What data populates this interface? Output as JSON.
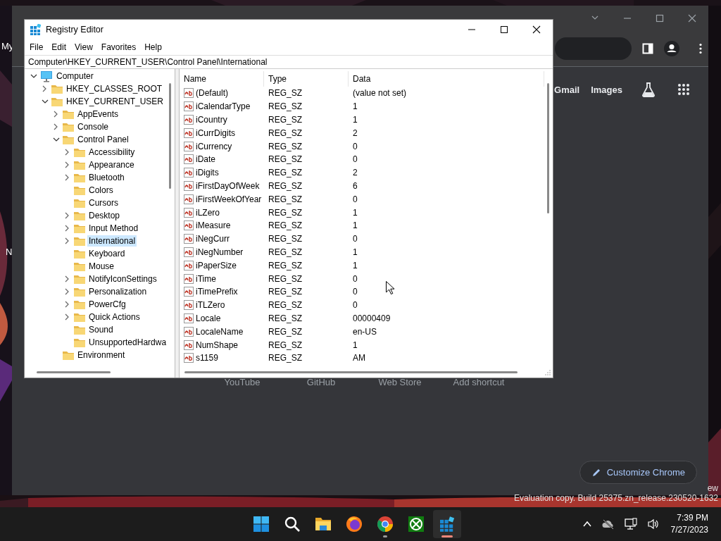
{
  "desktop": {
    "icon_labels": [
      "My",
      "N"
    ],
    "watermark_lines": [
      "ew",
      "Evaluation copy. Build 25375.zn_release.230520-1632"
    ]
  },
  "browser": {
    "header_links": [
      "Gmail",
      "Images"
    ],
    "shortcuts": [
      "YouTube",
      "GitHub",
      "Web Store",
      "Add shortcut"
    ],
    "customize_button": "Customize Chrome"
  },
  "registry_editor": {
    "title": "Registry Editor",
    "menu": [
      "File",
      "Edit",
      "View",
      "Favorites",
      "Help"
    ],
    "address": "Computer\\HKEY_CURRENT_USER\\Control Panel\\International",
    "tree": [
      {
        "label": "Computer",
        "kind": "computer",
        "expandable": true,
        "expanded": true,
        "selected": false,
        "children": [
          {
            "label": "HKEY_CLASSES_ROOT",
            "kind": "folder",
            "expandable": true,
            "expanded": false,
            "selected": false
          },
          {
            "label": "HKEY_CURRENT_USER",
            "kind": "folder",
            "expandable": true,
            "expanded": true,
            "selected": false,
            "children": [
              {
                "label": "AppEvents",
                "kind": "folder",
                "expandable": true,
                "expanded": false,
                "selected": false
              },
              {
                "label": "Console",
                "kind": "folder",
                "expandable": true,
                "expanded": false,
                "selected": false
              },
              {
                "label": "Control Panel",
                "kind": "folder",
                "expandable": true,
                "expanded": true,
                "selected": false,
                "children": [
                  {
                    "label": "Accessibility",
                    "kind": "folder",
                    "expandable": true,
                    "expanded": false,
                    "selected": false
                  },
                  {
                    "label": "Appearance",
                    "kind": "folder",
                    "expandable": true,
                    "expanded": false,
                    "selected": false
                  },
                  {
                    "label": "Bluetooth",
                    "kind": "folder",
                    "expandable": true,
                    "expanded": false,
                    "selected": false
                  },
                  {
                    "label": "Colors",
                    "kind": "folder",
                    "expandable": false,
                    "selected": false
                  },
                  {
                    "label": "Cursors",
                    "kind": "folder",
                    "expandable": false,
                    "selected": false
                  },
                  {
                    "label": "Desktop",
                    "kind": "folder",
                    "expandable": true,
                    "expanded": false,
                    "selected": false
                  },
                  {
                    "label": "Input Method",
                    "kind": "folder",
                    "expandable": true,
                    "expanded": false,
                    "selected": false
                  },
                  {
                    "label": "International",
                    "kind": "folder",
                    "expandable": true,
                    "expanded": false,
                    "selected": true
                  },
                  {
                    "label": "Keyboard",
                    "kind": "folder",
                    "expandable": false,
                    "selected": false
                  },
                  {
                    "label": "Mouse",
                    "kind": "folder",
                    "expandable": false,
                    "selected": false
                  },
                  {
                    "label": "NotifyIconSettings",
                    "kind": "folder",
                    "expandable": true,
                    "expanded": false,
                    "selected": false
                  },
                  {
                    "label": "Personalization",
                    "kind": "folder",
                    "expandable": true,
                    "expanded": false,
                    "selected": false
                  },
                  {
                    "label": "PowerCfg",
                    "kind": "folder",
                    "expandable": true,
                    "expanded": false,
                    "selected": false
                  },
                  {
                    "label": "Quick Actions",
                    "kind": "folder",
                    "expandable": true,
                    "expanded": false,
                    "selected": false
                  },
                  {
                    "label": "Sound",
                    "kind": "folder",
                    "expandable": false,
                    "selected": false
                  },
                  {
                    "label": "UnsupportedHardwa",
                    "kind": "folder",
                    "expandable": false,
                    "selected": false
                  }
                ]
              },
              {
                "label": "Environment",
                "kind": "folder",
                "expandable": false,
                "selected": false
              }
            ]
          }
        ]
      }
    ],
    "columns": [
      "Name",
      "Type",
      "Data"
    ],
    "rows": [
      {
        "name": "(Default)",
        "type": "REG_SZ",
        "data": "(value not set)"
      },
      {
        "name": "iCalendarType",
        "type": "REG_SZ",
        "data": "1"
      },
      {
        "name": "iCountry",
        "type": "REG_SZ",
        "data": "1"
      },
      {
        "name": "iCurrDigits",
        "type": "REG_SZ",
        "data": "2"
      },
      {
        "name": "iCurrency",
        "type": "REG_SZ",
        "data": "0"
      },
      {
        "name": "iDate",
        "type": "REG_SZ",
        "data": "0"
      },
      {
        "name": "iDigits",
        "type": "REG_SZ",
        "data": "2"
      },
      {
        "name": "iFirstDayOfWeek",
        "type": "REG_SZ",
        "data": "6"
      },
      {
        "name": "iFirstWeekOfYear",
        "type": "REG_SZ",
        "data": "0"
      },
      {
        "name": "iLZero",
        "type": "REG_SZ",
        "data": "1"
      },
      {
        "name": "iMeasure",
        "type": "REG_SZ",
        "data": "1"
      },
      {
        "name": "iNegCurr",
        "type": "REG_SZ",
        "data": "0"
      },
      {
        "name": "iNegNumber",
        "type": "REG_SZ",
        "data": "1"
      },
      {
        "name": "iPaperSize",
        "type": "REG_SZ",
        "data": "1"
      },
      {
        "name": "iTime",
        "type": "REG_SZ",
        "data": "0"
      },
      {
        "name": "iTimePrefix",
        "type": "REG_SZ",
        "data": "0"
      },
      {
        "name": "iTLZero",
        "type": "REG_SZ",
        "data": "0"
      },
      {
        "name": "Locale",
        "type": "REG_SZ",
        "data": "00000409"
      },
      {
        "name": "LocaleName",
        "type": "REG_SZ",
        "data": "en-US"
      },
      {
        "name": "NumShape",
        "type": "REG_SZ",
        "data": "1"
      },
      {
        "name": "s1159",
        "type": "REG_SZ",
        "data": "AM"
      }
    ]
  },
  "taskbar": {
    "apps": [
      {
        "kind": "start",
        "running": false,
        "active": false
      },
      {
        "kind": "search",
        "running": false,
        "active": false
      },
      {
        "kind": "explorer",
        "running": false,
        "active": false
      },
      {
        "kind": "firefox",
        "running": false,
        "active": false
      },
      {
        "kind": "chrome",
        "running": true,
        "active": false
      },
      {
        "kind": "xbox",
        "running": false,
        "active": false
      },
      {
        "kind": "regedit",
        "running": true,
        "active": true
      }
    ],
    "clock": {
      "time": "7:39 PM",
      "date": "7/27/2023"
    }
  }
}
